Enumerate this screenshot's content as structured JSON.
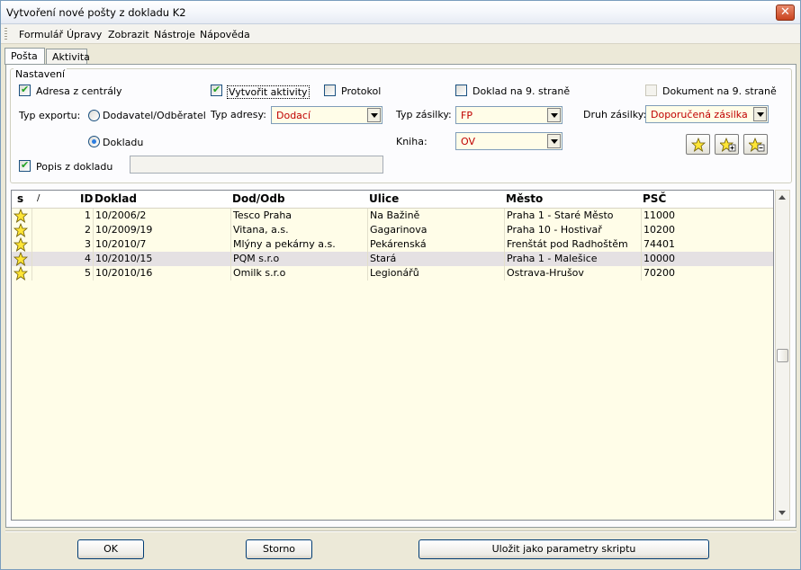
{
  "window": {
    "title": "Vytvoření nové pošty z dokladu K2"
  },
  "menu": [
    "Formulář",
    "Úpravy",
    "Zobrazit",
    "Nástroje",
    "Nápověda"
  ],
  "tabs": [
    {
      "label": "Pošta",
      "active": true
    },
    {
      "label": "Aktivita",
      "active": false
    }
  ],
  "settings": {
    "legend": "Nastavení",
    "adresa_z_centraly": {
      "label": "Adresa z centrály",
      "checked": true
    },
    "vytvorit_aktivity": {
      "label": "Vytvořit aktivity",
      "checked": true
    },
    "protokol": {
      "label": "Protokol",
      "checked": false
    },
    "doklad_na_9_strane": {
      "label": "Doklad na 9. straně",
      "checked": false
    },
    "dokument_na_9_strane": {
      "label": "Dokument na 9. straně",
      "checked": false,
      "disabled": true
    },
    "typ_exportu": {
      "label": "Typ exportu:",
      "options": [
        "Dodavatel/Odběratel",
        "Dokladu"
      ],
      "selected": "Dokladu"
    },
    "typ_adresy": {
      "label": "Typ adresy:",
      "value": "Dodací"
    },
    "typ_zasilky": {
      "label": "Typ zásilky:",
      "value": "FP"
    },
    "druh_zasilky": {
      "label": "Druh zásilky:",
      "value": "Doporučená zásilka"
    },
    "kniha": {
      "label": "Kniha:",
      "value": "OV"
    },
    "popis_z_dokladu": {
      "label": "Popis z dokladu",
      "checked": true,
      "value": ""
    }
  },
  "grid": {
    "columns": [
      "s",
      "/",
      "ID",
      "Doklad",
      "Dod/Odb",
      "Ulice",
      "Město",
      "PSČ"
    ],
    "rows": [
      {
        "id": "1",
        "doklad": "10/2006/2",
        "dod": "Tesco Praha",
        "ulice": "Na Bažině",
        "mesto": "Praha 1 - Staré Město",
        "psc": "11000"
      },
      {
        "id": "2",
        "doklad": "10/2009/19",
        "dod": "Vitana, a.s.",
        "ulice": "Gagarinova",
        "mesto": "Praha 10 - Hostivař",
        "psc": "10200"
      },
      {
        "id": "3",
        "doklad": "10/2010/7",
        "dod": "Mlýny a pekárny a.s.",
        "ulice": "Pekárenská",
        "mesto": "Frenštát pod Radhoštěm",
        "psc": "74401"
      },
      {
        "id": "4",
        "doklad": "10/2010/15",
        "dod": "PQM s.r.o",
        "ulice": "Stará",
        "mesto": "Praha 1 - Malešice",
        "psc": "10000",
        "selected": true
      },
      {
        "id": "5",
        "doklad": "10/2010/16",
        "dod": "Omilk s.r.o",
        "ulice": "Legionářů",
        "mesto": "Ostrava-Hrušov",
        "psc": "70200"
      }
    ]
  },
  "buttons": {
    "ok": "OK",
    "storno": "Storno",
    "save": "Uložit jako parametry skriptu"
  },
  "colors": {
    "accent_text": "#c00000",
    "grid_bg": "#fffde8",
    "selected_row": "#e5e1e3"
  }
}
